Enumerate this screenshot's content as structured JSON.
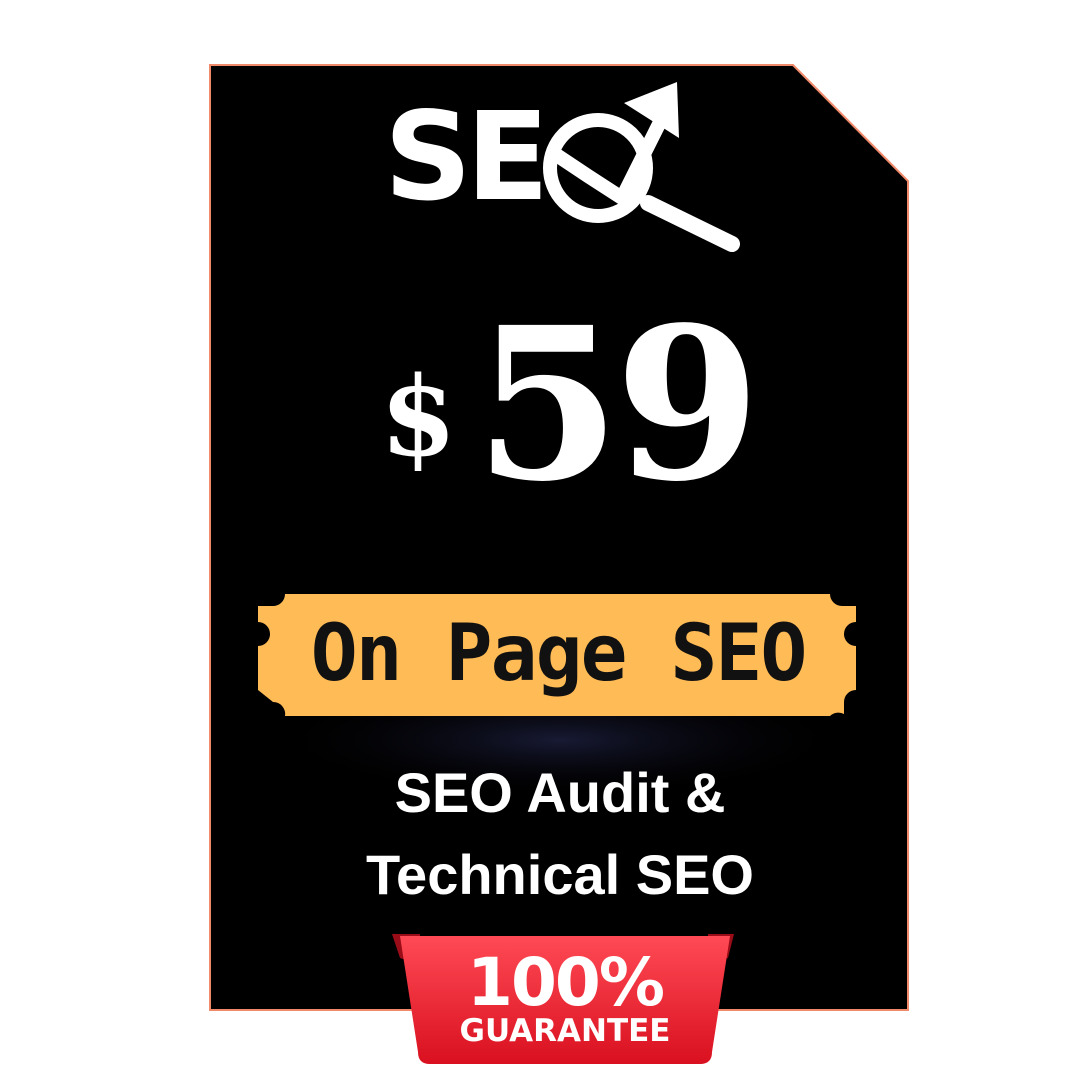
{
  "logo": {
    "text": "SE",
    "icon": "magnifier-growth-arrow-icon"
  },
  "price": {
    "currency": "$",
    "amount": "59"
  },
  "ribbon": {
    "label": "On Page SEO",
    "color": "#ffbb56"
  },
  "subtitle": {
    "line1": "SEO Audit &",
    "line2": "Technical SEO"
  },
  "badge": {
    "top": "100%",
    "bottom": "GUARANTEE",
    "color": "#ee1c2e"
  },
  "colors": {
    "card": "#000000",
    "border": "#f08a6a",
    "text": "#ffffff"
  }
}
